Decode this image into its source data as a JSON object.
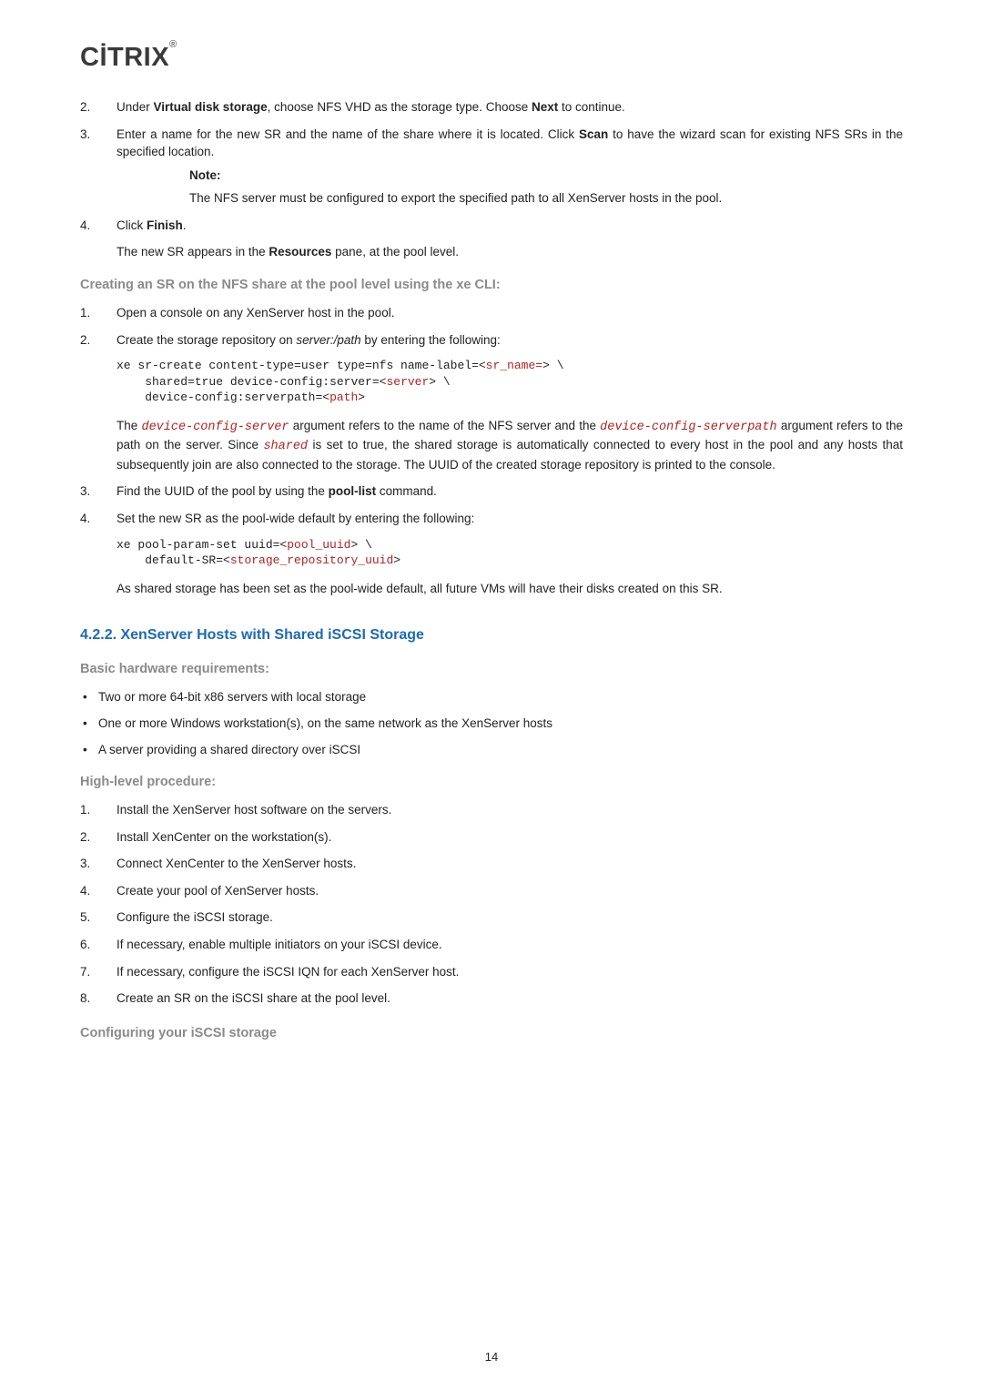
{
  "logo": "CİTRIX",
  "step2": {
    "n": "2.",
    "text_a": "Under ",
    "b1": "Virtual disk storage",
    "text_b": ", choose NFS VHD as the storage type. Choose ",
    "b2": "Next",
    "text_c": " to continue."
  },
  "step3": {
    "n": "3.",
    "text_a": "Enter a name for the new SR and the name of the share where it is located. Click ",
    "b1": "Scan",
    "text_b": " to have the wizard scan for existing NFS SRs in the specified location."
  },
  "note_label": "Note:",
  "note_body": "The NFS server must be configured to export the specified path to all XenServer hosts in the pool.",
  "step4": {
    "n": "4.",
    "text_a": "Click ",
    "b1": "Finish",
    "text_b": "."
  },
  "step4_sub_a": "The new SR appears in the ",
  "step4_sub_b": "Resources",
  "step4_sub_c": " pane, at the pool level.",
  "h_creating": "Creating an SR on the NFS share at the pool level using the xe CLI:",
  "cli1_a": {
    "n": "1.",
    "text": "Open a console on any XenServer host in the pool."
  },
  "cli1_b": {
    "n": "2.",
    "text_a": "Create the storage repository on ",
    "i": "server:/path",
    "text_b": " by entering the following:"
  },
  "code1": {
    "l1a": "xe sr-create content-type=user type=nfs name-label=<",
    "l1p": "sr_name=",
    "l1b": "> \\",
    "l2a": "    shared=true device-config:server=<",
    "l2p": "server",
    "l2b": "> \\",
    "l3a": "    device-config:serverpath=<",
    "l3p": "path",
    "l3b": ">"
  },
  "cli1_b_para_a": "The ",
  "cli1_m1": "device-config-server",
  "cli1_b_para_b": " argument refers to the name of the NFS server and the ",
  "cli1_m2": "device-config-serverpath",
  "cli1_b_para_c": " argument refers to the path on the server. Since ",
  "cli1_m3": "shared",
  "cli1_b_para_d": " is set to true, the shared storage is automatically connected to every host in the pool and any hosts that subsequently join are also connected to the storage. The UUID of the created storage repository is printed to the console.",
  "cli1_c": {
    "n": "3.",
    "text_a": "Find the UUID of the pool by using the ",
    "b1": "pool-list",
    "text_b": " command."
  },
  "cli1_d": {
    "n": "4.",
    "text": "Set the new SR as the pool-wide default by entering the following:"
  },
  "code2": {
    "l1a": "xe pool-param-set uuid=<",
    "l1p": "pool_uuid",
    "l1b": "> \\",
    "l2a": "    default-SR=<",
    "l2p": "storage_repository_uuid",
    "l2b": ">"
  },
  "cli1_d_sub": "As shared storage has been set as the pool-wide default, all future VMs will have their disks created on this SR.",
  "h_section": "4.2.2. XenServer Hosts with Shared iSCSI Storage",
  "h_basic": "Basic hardware requirements:",
  "hw": [
    "Two or more 64-bit x86 servers with local storage",
    "One or more Windows workstation(s), on the same network as the XenServer hosts",
    "A server providing a shared directory over iSCSI"
  ],
  "h_high": "High-level procedure:",
  "steps": [
    {
      "n": "1.",
      "t": "Install the XenServer host software on the servers."
    },
    {
      "n": "2.",
      "t": "Install XenCenter on the workstation(s)."
    },
    {
      "n": "3.",
      "t": "Connect XenCenter to the XenServer hosts."
    },
    {
      "n": "4.",
      "t": "Create your pool of XenServer hosts."
    },
    {
      "n": "5.",
      "t": "Configure the iSCSI storage."
    },
    {
      "n": "6.",
      "t": "If necessary, enable multiple initiators on your iSCSI device."
    },
    {
      "n": "7.",
      "t": "If necessary, configure the iSCSI IQN for each XenServer host."
    },
    {
      "n": "8.",
      "t": "Create an SR on the iSCSI share at the pool level."
    }
  ],
  "h_conf": "Configuring your iSCSI storage",
  "pagenum": "14"
}
